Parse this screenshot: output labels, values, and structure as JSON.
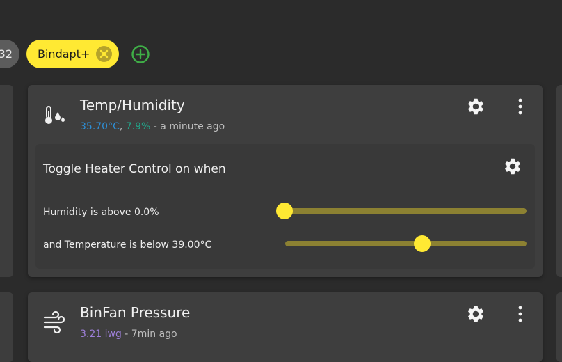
{
  "chips": {
    "partial_label": "32",
    "active_label": "Bindapt+"
  },
  "cards": [
    {
      "title": "Temp/Humidity",
      "reading_temp": "35.70°C",
      "separator": ", ",
      "reading_humidity": "7.9%",
      "time": " - a minute ago",
      "icon": "thermometer-droplets-icon",
      "rule": {
        "title": "Toggle Heater Control on when",
        "condition1": "Humidity is above 0.0%",
        "condition1_value": 0.0,
        "condition2": "and Temperature is below 39.00°C",
        "condition2_value": 39.0
      }
    },
    {
      "title": "BinFan Pressure",
      "reading_pressure": "3.21 iwg",
      "time": " - 7min ago",
      "icon": "wind-icon"
    }
  ],
  "colors": {
    "accent": "#ffe933",
    "temperature": "#2e8fd6",
    "humidity": "#22a58a",
    "pressure": "#9d7fd8",
    "add": "#3fae47"
  }
}
